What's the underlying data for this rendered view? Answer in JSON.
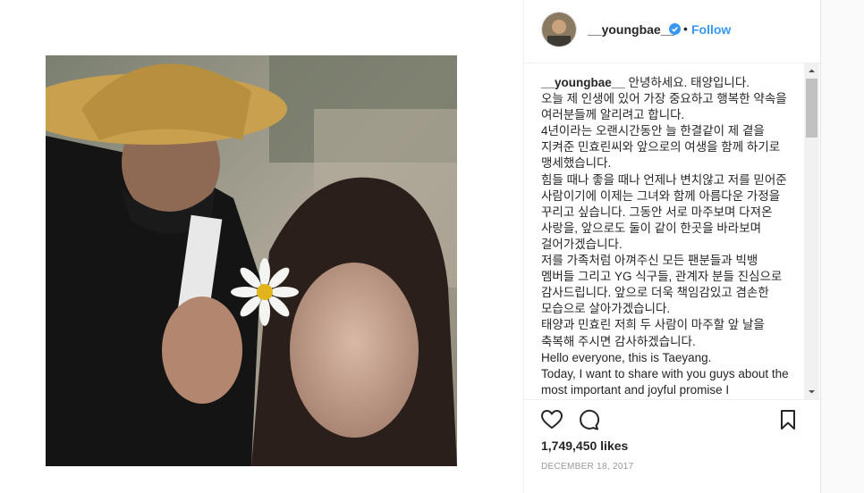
{
  "post": {
    "username": "__youngbae__",
    "follow_label": "Follow",
    "separator": "•",
    "caption_user": "__youngbae__",
    "caption_text": " 안녕하세요. 태양입니다.\n오늘 제 인생에 있어 가장 중요하고 행복한 약속을 여러분들께 알리려고 합니다.\n4년이라는 오랜시간동안 늘 한결같이 제 곁을 지켜준 민효린씨와 앞으로의 여생을 함께 하기로 맹세했습니다.\n힘들 때나 좋을 때나 언제나 변치않고 저를 믿어준 사람이기에 이제는 그녀와 함께 아름다운 가정을 꾸리고 싶습니다. 그동안 서로 마주보며 다져온 사랑을, 앞으로도 둘이 같이 한곳을 바라보며 걸어가겠습니다.\n저를 가족처럼 아껴주신 모든 팬분들과 빅뱅 멤버들 그리고 YG 식구들, 관계자 분들 진심으로 감사드립니다. 앞으로 더욱 책임감있고 겸손한 모습으로 살아가겠습니다.\n태양과 민효린 저희 두 사람이 마주할 앞 날을 축복해 주시면 감사하겠습니다.\nHello everyone, this is Taeyang.\nToday, I want to share with you guys about the most important and joyful promise I",
    "likes": "1,749,450 likes",
    "date": "DECEMBER 18, 2017"
  },
  "colors": {
    "accent": "#3897f0",
    "text": "#262626",
    "muted": "#999999"
  },
  "icons": [
    "verified-badge-icon",
    "heart-icon",
    "comment-icon",
    "bookmark-icon",
    "scroll-up-arrow-icon",
    "scroll-down-arrow-icon"
  ]
}
